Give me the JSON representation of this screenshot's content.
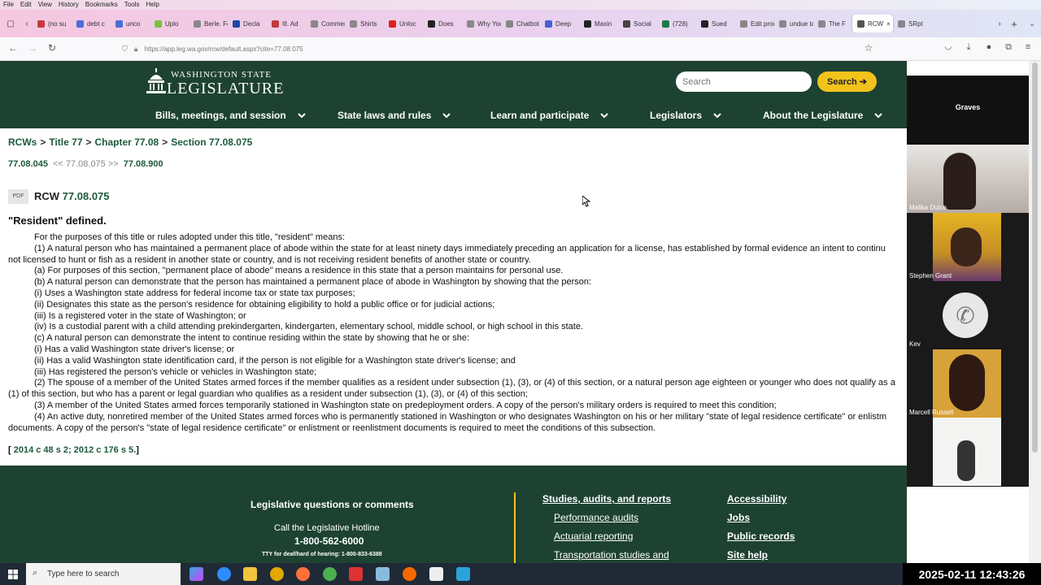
{
  "browser": {
    "menu": [
      "File",
      "Edit",
      "View",
      "History",
      "Bookmarks",
      "Tools",
      "Help"
    ],
    "tabs": [
      {
        "label": "(no su",
        "color": "#c23b3b"
      },
      {
        "label": "debt c",
        "color": "#4a6fd8"
      },
      {
        "label": "unco",
        "color": "#4a6fd8"
      },
      {
        "label": "Uplo",
        "color": "#7ac043"
      },
      {
        "label": "Berle. For",
        "color": "#888"
      },
      {
        "label": "Decla",
        "color": "#1b4aa8"
      },
      {
        "label": "Ill. Ad",
        "color": "#c23b3b"
      },
      {
        "label": "Commen",
        "color": "#888"
      },
      {
        "label": "Shirts",
        "color": "#888"
      },
      {
        "label": "Unloc",
        "color": "#e0201c"
      },
      {
        "label": "Does",
        "color": "#222"
      },
      {
        "label": "Why Your",
        "color": "#888"
      },
      {
        "label": "Chatbot A",
        "color": "#888"
      },
      {
        "label": "Deep",
        "color": "#4a5fd8"
      },
      {
        "label": "Maxin",
        "color": "#222"
      },
      {
        "label": "Social",
        "color": "#444"
      },
      {
        "label": "(728)",
        "color": "#1d7a4a"
      },
      {
        "label": "Sued",
        "color": "#222"
      },
      {
        "label": "Edit produ",
        "color": "#888"
      },
      {
        "label": "undue tax",
        "color": "#888"
      },
      {
        "label": "The F",
        "color": "#888"
      },
      {
        "label": "RCW",
        "color": "#555",
        "active": true
      },
      {
        "label": "SRpt",
        "color": "#888"
      }
    ],
    "url": "https://app.leg.wa.gov/rcw/default.aspx?cite=77.08.075"
  },
  "header": {
    "logo_line1": "WASHINGTON STATE",
    "logo_line2": "LEGISLATURE",
    "search_placeholder": "Search",
    "search_button": "Search"
  },
  "nav": [
    {
      "label": "Bills, meetings, and session"
    },
    {
      "label": "State laws and rules"
    },
    {
      "label": "Learn and participate"
    },
    {
      "label": "Legislators"
    },
    {
      "label": "About the Legislature"
    }
  ],
  "breadcrumb": [
    "RCWs",
    "Title 77",
    "Chapter 77.08",
    "Section 77.08.075"
  ],
  "prevnext": {
    "prev": "77.08.045",
    "current": "77.08.075",
    "next": "77.08.900"
  },
  "pdf_label": "PDF",
  "rcw": {
    "prefix": "RCW",
    "number": "77.08.075"
  },
  "section_title": "\"Resident\" defined.",
  "body_lines": [
    {
      "t": "For the purposes of this title or rules adopted under this title, \"resident\" means:",
      "ind": true
    },
    {
      "t": "(1) A natural person who has maintained a permanent place of abode within the state for at least ninety days immediately preceding an application for a license, has established by formal evidence an intent to continu",
      "ind": true
    },
    {
      "t": "not licensed to hunt or fish as a resident in another state or country, and is not receiving resident benefits of another state or country.",
      "ind": false
    },
    {
      "t": "(a) For purposes of this section, \"permanent place of abode\" means a residence in this state that a person maintains for personal use.",
      "ind": true
    },
    {
      "t": "(b) A natural person can demonstrate that the person has maintained a permanent place of abode in Washington by showing that the person:",
      "ind": true
    },
    {
      "t": "(i) Uses a Washington state address for federal income tax or state tax purposes;",
      "ind": true
    },
    {
      "t": "(ii) Designates this state as the person's residence for obtaining eligibility to hold a public office or for judicial actions;",
      "ind": true
    },
    {
      "t": "(iii) Is a registered voter in the state of Washington; or",
      "ind": true
    },
    {
      "t": "(iv) Is a custodial parent with a child attending prekindergarten, kindergarten, elementary school, middle school, or high school in this state.",
      "ind": true
    },
    {
      "t": "(c) A natural person can demonstrate the intent to continue residing within the state by showing that he or she:",
      "ind": true
    },
    {
      "t": "(i) Has a valid Washington state driver's license; or",
      "ind": true
    },
    {
      "t": "(ii) Has a valid Washington state identification card, if the person is not eligible for a Washington state driver's license; and",
      "ind": true
    },
    {
      "t": "(iii) Has registered the person's vehicle or vehicles in Washington state;",
      "ind": true
    },
    {
      "t": "(2) The spouse of a member of the United States armed forces if the member qualifies as a resident under subsection (1), (3), or (4) of this section, or a natural person age eighteen or younger who does not qualify as a",
      "ind": true
    },
    {
      "t": "(1) of this section, but who has a parent or legal guardian who qualifies as a resident under subsection (1), (3), or (4) of this section;",
      "ind": false
    },
    {
      "t": "(3) A member of the United States armed forces temporarily stationed in Washington state on predeployment orders. A copy of the person's military orders is required to meet this condition;",
      "ind": true
    },
    {
      "t": "(4) An active duty, nonretired member of the United States armed forces who is permanently stationed in Washington or who designates Washington on his or her military \"state of legal residence certificate\" or enlistm",
      "ind": true
    },
    {
      "t": "documents. A copy of the person's \"state of legal residence certificate\" or enlistment or reenlistment documents is required to meet the conditions of this subsection.",
      "ind": false
    }
  ],
  "history": {
    "open": "[",
    "text": "2014 c 48 s 2; 2012 c 176 s 5.",
    "close": "]"
  },
  "footer": {
    "questions": "Legislative questions or comments",
    "call": "Call the Legislative Hotline",
    "phone": "1-800-562-6000",
    "tty": "TTY for deaf/hard of hearing: 1-800-833-6388",
    "col1": {
      "heading": "Studies, audits, and reports",
      "items": [
        "Performance audits",
        "Actuarial reporting",
        "Transportation studies and"
      ]
    },
    "col2": [
      "Accessibility",
      "Jobs",
      "Public records",
      "Site help"
    ]
  },
  "zoom": {
    "header_name": "Graves",
    "participants": [
      "Malika Dulce",
      "Stephen Grant",
      "Kev",
      "Marcell Russell",
      ""
    ]
  },
  "taskbar": {
    "search_placeholder": "Type here to search",
    "clock": "2025-02-11 12:43:26"
  }
}
